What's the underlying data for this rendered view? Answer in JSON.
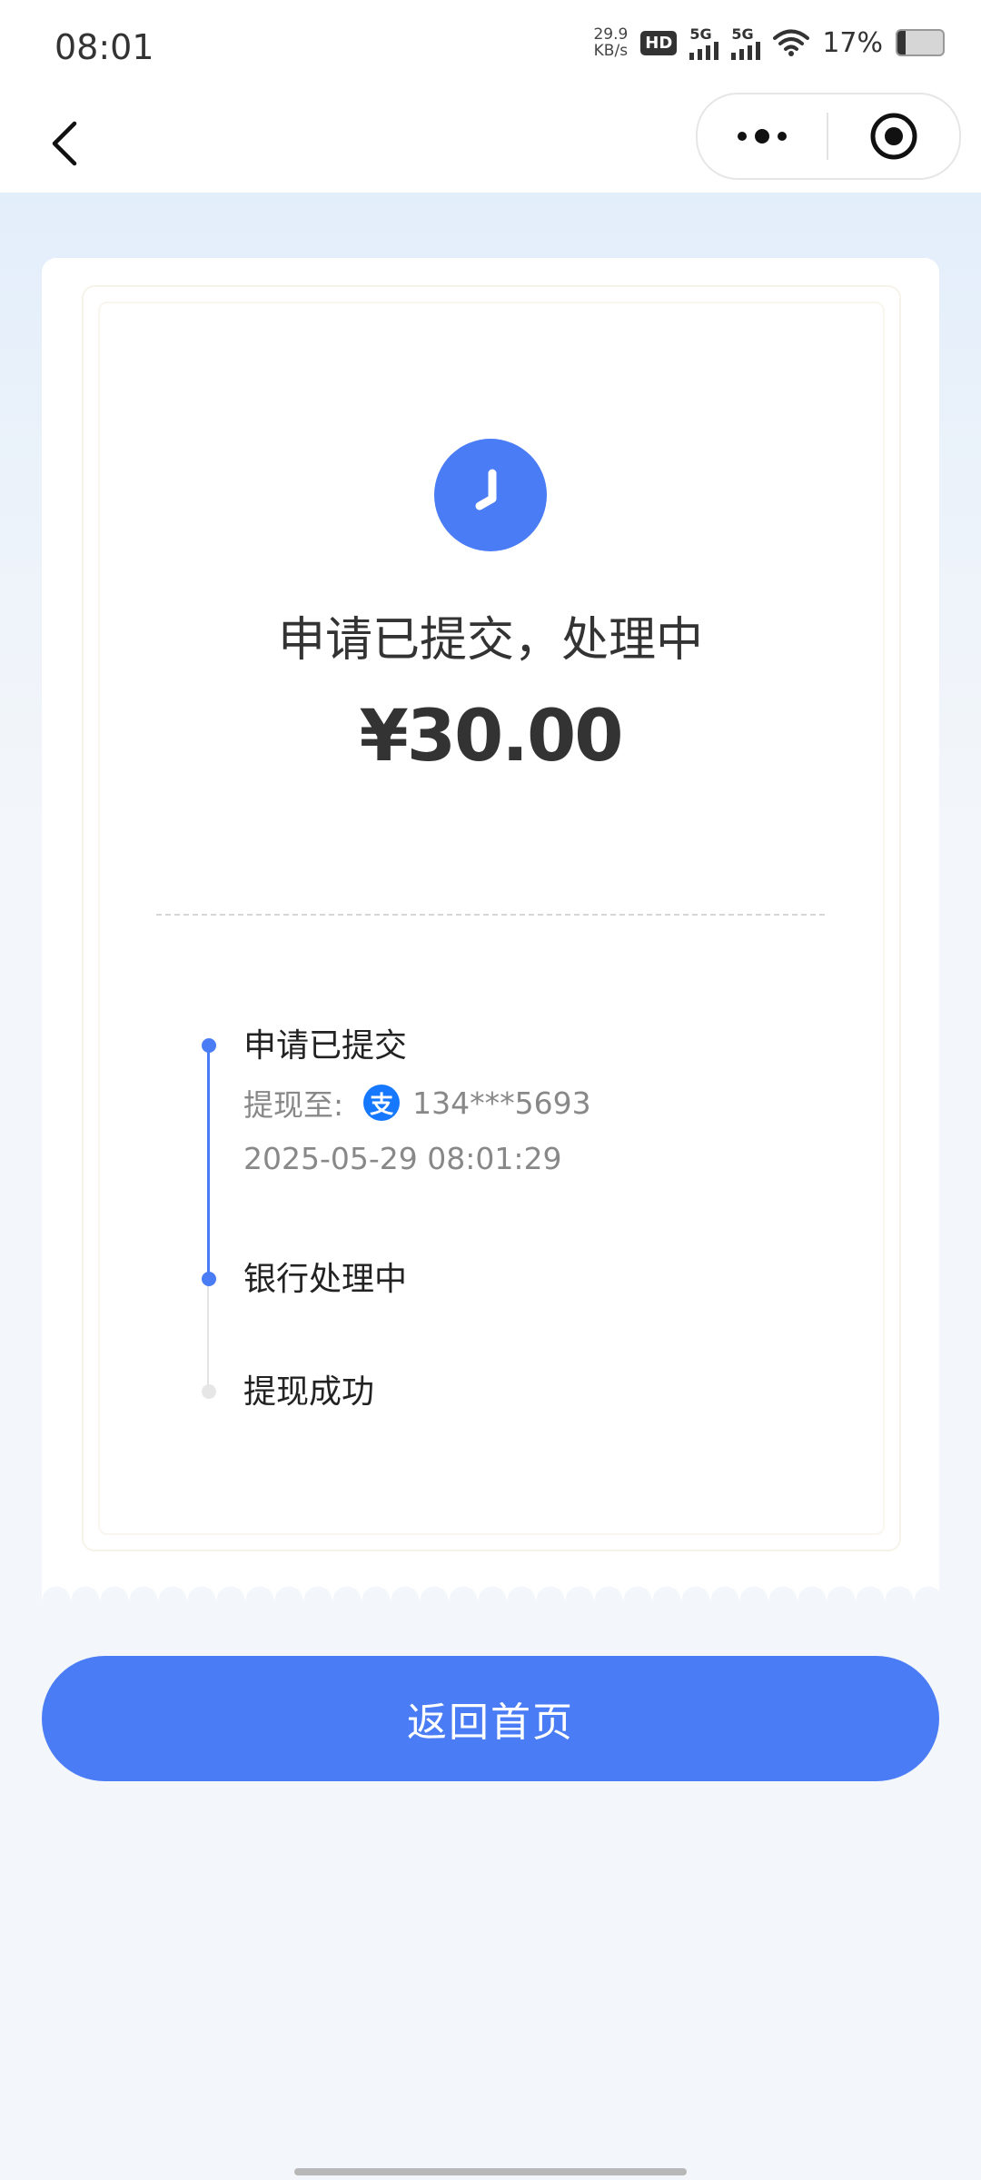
{
  "status_bar": {
    "time": "08:01",
    "net_speed_value": "29.9",
    "net_speed_unit": "KB/s",
    "hd_label": "HD",
    "signal1_label": "5G",
    "signal2_label": "5G",
    "battery_text": "17%"
  },
  "nav": {
    "back_icon": "chevron-left-icon",
    "more_icon": "more-dots-icon",
    "close_icon": "target-icon"
  },
  "receipt": {
    "status_icon": "clock-icon",
    "status_title": "申请已提交，处理中",
    "amount": "¥30.00",
    "timeline": [
      {
        "title": "申请已提交",
        "state": "done",
        "withdraw_label": "提现至:",
        "account": "134***5693",
        "time": "2025-05-29 08:01:29"
      },
      {
        "title": "银行处理中",
        "state": "active"
      },
      {
        "title": "提现成功",
        "state": "pending"
      }
    ]
  },
  "actions": {
    "home_label": "返回首页"
  },
  "colors": {
    "accent": "#4a7cf5",
    "alipay": "#1677ff"
  }
}
